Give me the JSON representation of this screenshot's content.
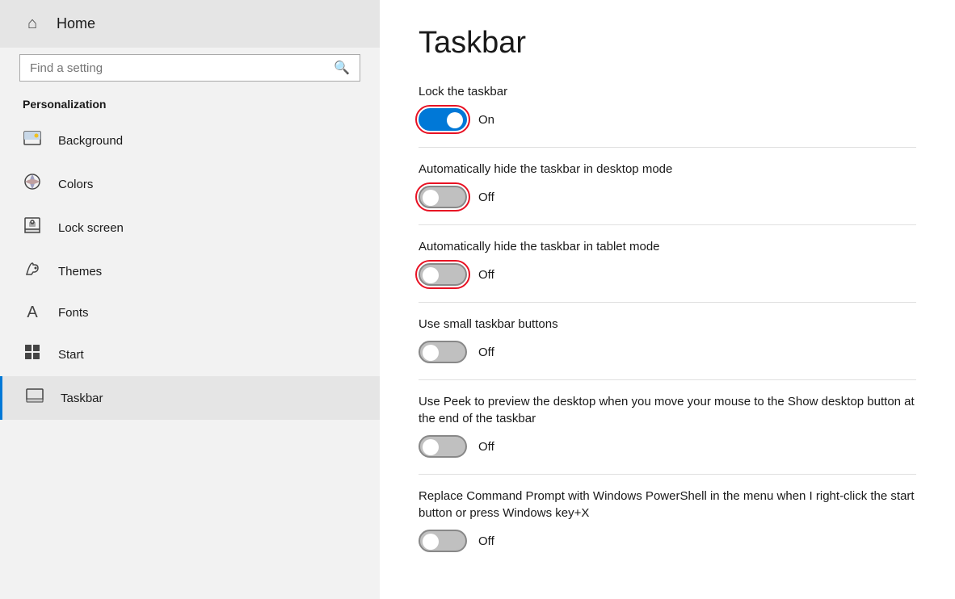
{
  "sidebar": {
    "home_label": "Home",
    "search_placeholder": "Find a setting",
    "section_title": "Personalization",
    "items": [
      {
        "id": "background",
        "label": "Background",
        "icon": "bg"
      },
      {
        "id": "colors",
        "label": "Colors",
        "icon": "colors"
      },
      {
        "id": "lock-screen",
        "label": "Lock screen",
        "icon": "lock"
      },
      {
        "id": "themes",
        "label": "Themes",
        "icon": "themes"
      },
      {
        "id": "fonts",
        "label": "Fonts",
        "icon": "fonts"
      },
      {
        "id": "start",
        "label": "Start",
        "icon": "start"
      },
      {
        "id": "taskbar",
        "label": "Taskbar",
        "icon": "taskbar",
        "active": true
      }
    ]
  },
  "main": {
    "title": "Taskbar",
    "settings": [
      {
        "id": "lock-taskbar",
        "label": "Lock the taskbar",
        "state": "on",
        "state_label": "On",
        "highlighted": true
      },
      {
        "id": "auto-hide-desktop",
        "label": "Automatically hide the taskbar in desktop mode",
        "state": "off",
        "state_label": "Off",
        "highlighted": true
      },
      {
        "id": "auto-hide-tablet",
        "label": "Automatically hide the taskbar in tablet mode",
        "state": "off",
        "state_label": "Off",
        "highlighted": true
      },
      {
        "id": "small-buttons",
        "label": "Use small taskbar buttons",
        "state": "off",
        "state_label": "Off",
        "highlighted": false
      },
      {
        "id": "peek-preview",
        "label": "Use Peek to preview the desktop when you move your mouse to the Show desktop button at the end of the taskbar",
        "state": "off",
        "state_label": "Off",
        "highlighted": false
      },
      {
        "id": "replace-cmd",
        "label": "Replace Command Prompt with Windows PowerShell in the menu when I right-click the start button or press Windows key+X",
        "state": "off",
        "state_label": "Off",
        "highlighted": false
      }
    ]
  }
}
